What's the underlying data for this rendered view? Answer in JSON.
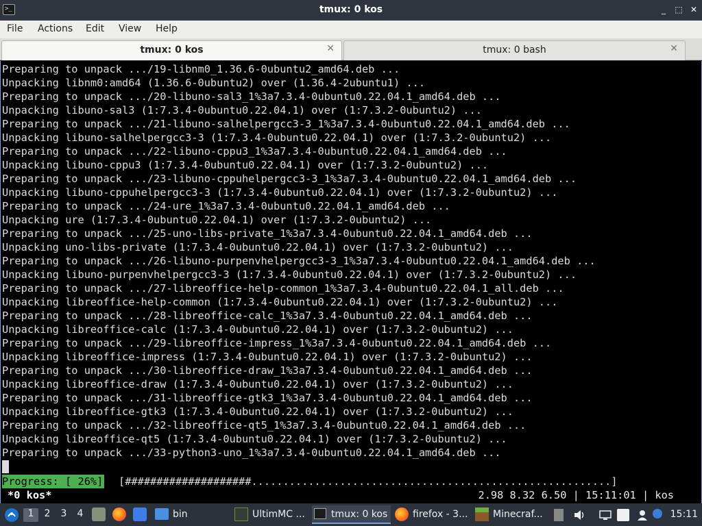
{
  "window": {
    "title": "tmux: 0 kos",
    "controls": [
      "_",
      "⬚",
      "✕"
    ]
  },
  "menu": [
    "File",
    "Actions",
    "Edit",
    "View",
    "Help"
  ],
  "tabs": [
    {
      "label": "tmux: 0 kos",
      "close": "✕"
    },
    {
      "label": "tmux: 0 bash",
      "close": "✕"
    }
  ],
  "terminal": {
    "lines": [
      "Preparing to unpack .../19-libnm0_1.36.6-0ubuntu2_amd64.deb ...",
      "Unpacking libnm0:amd64 (1.36.6-0ubuntu2) over (1.36.4-2ubuntu1) ...",
      "Preparing to unpack .../20-libuno-sal3_1%3a7.3.4-0ubuntu0.22.04.1_amd64.deb ...",
      "Unpacking libuno-sal3 (1:7.3.4-0ubuntu0.22.04.1) over (1:7.3.2-0ubuntu2) ...",
      "Preparing to unpack .../21-libuno-salhelpergcc3-3_1%3a7.3.4-0ubuntu0.22.04.1_amd64.deb ...",
      "Unpacking libuno-salhelpergcc3-3 (1:7.3.4-0ubuntu0.22.04.1) over (1:7.3.2-0ubuntu2) ...",
      "Preparing to unpack .../22-libuno-cppu3_1%3a7.3.4-0ubuntu0.22.04.1_amd64.deb ...",
      "Unpacking libuno-cppu3 (1:7.3.4-0ubuntu0.22.04.1) over (1:7.3.2-0ubuntu2) ...",
      "Preparing to unpack .../23-libuno-cppuhelpergcc3-3_1%3a7.3.4-0ubuntu0.22.04.1_amd64.deb ...",
      "Unpacking libuno-cppuhelpergcc3-3 (1:7.3.4-0ubuntu0.22.04.1) over (1:7.3.2-0ubuntu2) ...",
      "Preparing to unpack .../24-ure_1%3a7.3.4-0ubuntu0.22.04.1_amd64.deb ...",
      "Unpacking ure (1:7.3.4-0ubuntu0.22.04.1) over (1:7.3.2-0ubuntu2) ...",
      "Preparing to unpack .../25-uno-libs-private_1%3a7.3.4-0ubuntu0.22.04.1_amd64.deb ...",
      "Unpacking uno-libs-private (1:7.3.4-0ubuntu0.22.04.1) over (1:7.3.2-0ubuntu2) ...",
      "Preparing to unpack .../26-libuno-purpenvhelpergcc3-3_1%3a7.3.4-0ubuntu0.22.04.1_amd64.deb ...",
      "Unpacking libuno-purpenvhelpergcc3-3 (1:7.3.4-0ubuntu0.22.04.1) over (1:7.3.2-0ubuntu2) ...",
      "Preparing to unpack .../27-libreoffice-help-common_1%3a7.3.4-0ubuntu0.22.04.1_all.deb ...",
      "Unpacking libreoffice-help-common (1:7.3.4-0ubuntu0.22.04.1) over (1:7.3.2-0ubuntu2) ...",
      "Preparing to unpack .../28-libreoffice-calc_1%3a7.3.4-0ubuntu0.22.04.1_amd64.deb ...",
      "Unpacking libreoffice-calc (1:7.3.4-0ubuntu0.22.04.1) over (1:7.3.2-0ubuntu2) ...",
      "Preparing to unpack .../29-libreoffice-impress_1%3a7.3.4-0ubuntu0.22.04.1_amd64.deb ...",
      "Unpacking libreoffice-impress (1:7.3.4-0ubuntu0.22.04.1) over (1:7.3.2-0ubuntu2) ...",
      "Preparing to unpack .../30-libreoffice-draw_1%3a7.3.4-0ubuntu0.22.04.1_amd64.deb ...",
      "Unpacking libreoffice-draw (1:7.3.4-0ubuntu0.22.04.1) over (1:7.3.2-0ubuntu2) ...",
      "Preparing to unpack .../31-libreoffice-gtk3_1%3a7.3.4-0ubuntu0.22.04.1_amd64.deb ...",
      "Unpacking libreoffice-gtk3 (1:7.3.4-0ubuntu0.22.04.1) over (1:7.3.2-0ubuntu2) ...",
      "Preparing to unpack .../32-libreoffice-qt5_1%3a7.3.4-0ubuntu0.22.04.1_amd64.deb ...",
      "Unpacking libreoffice-qt5 (1:7.3.4-0ubuntu0.22.04.1) over (1:7.3.2-0ubuntu2) ...",
      "Preparing to unpack .../33-python3-uno_1%3a7.3.4-0ubuntu0.22.04.1_amd64.deb ..."
    ],
    "progress_label": "Progress: [ 26%]",
    "progress_bar": "[####################.........................................................]",
    "progress_percent": 26,
    "status_window": "*0 kos*",
    "status_right": "2.98 8.32 6.50 | 15:11:01 | kos"
  },
  "taskbar": {
    "desktops": [
      "1",
      "2",
      "3",
      "4"
    ],
    "active_desktop": "1",
    "folder_label": "bin",
    "tasks": [
      {
        "label": "UltimMC ...",
        "icon": "ultimmc-icon"
      },
      {
        "label": "tmux: 0 kos",
        "icon": "terminal-icon"
      },
      {
        "label": "firefox - 3...",
        "icon": "firefox-icon"
      },
      {
        "label": "Minecraf...",
        "icon": "minecraft-icon"
      }
    ],
    "clock": "15:11"
  },
  "colors": {
    "titlebar": "#2f343f",
    "progress_green": "#4caf50",
    "taskbar": "#2c323c",
    "terminal_bg": "#000000"
  }
}
